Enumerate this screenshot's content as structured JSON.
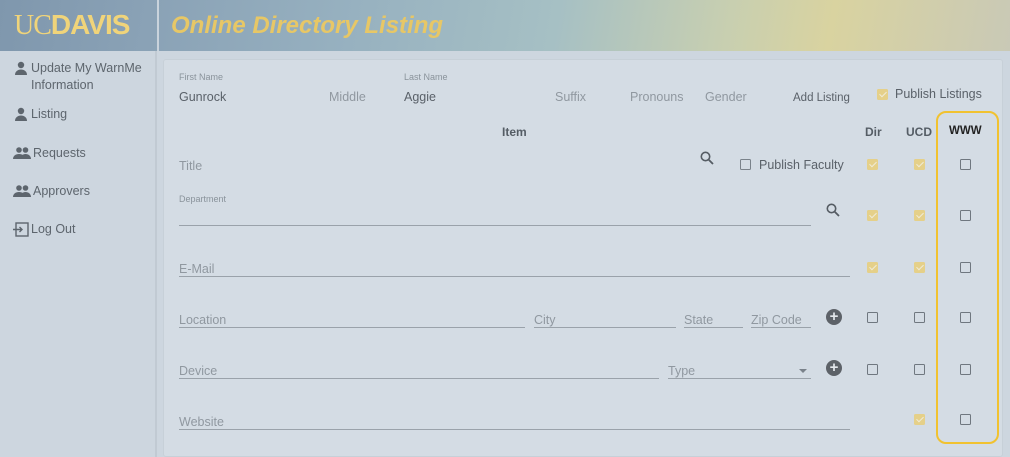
{
  "header": {
    "logo_uc": "UC",
    "logo_davis": "DAVIS",
    "app_title": "Online Directory Listing"
  },
  "sidebar": {
    "items": [
      {
        "label": "Update My WarnMe Information",
        "icon": "person-icon"
      },
      {
        "label": "Listing",
        "icon": "person-icon"
      },
      {
        "label": "Requests",
        "icon": "people-icon"
      },
      {
        "label": "Approvers",
        "icon": "people-icon"
      },
      {
        "label": "Log Out",
        "icon": "logout-icon"
      }
    ]
  },
  "name_row": {
    "first_name_label": "First Name",
    "first_name_value": "Gunrock",
    "middle_placeholder": "Middle",
    "last_name_label": "Last Name",
    "last_name_value": "Aggie",
    "suffix_placeholder": "Suffix",
    "pronouns_placeholder": "Pronouns",
    "gender_placeholder": "Gender",
    "add_listing": "Add Listing",
    "publish_listings": "Publish Listings",
    "publish_listings_checked": true
  },
  "columns": {
    "item": "Item",
    "dir": "Dir",
    "ucd": "UCD",
    "www": "WWW"
  },
  "rows": {
    "title": {
      "placeholder": "Title",
      "publish_faculty": "Publish Faculty",
      "dir": true,
      "ucd": true,
      "www": false
    },
    "department": {
      "label": "Department",
      "dir": true,
      "ucd": true,
      "www": false
    },
    "email": {
      "placeholder": "E-Mail",
      "dir": true,
      "ucd": true,
      "www": false
    },
    "location": {
      "location": "Location",
      "city": "City",
      "state": "State",
      "zip": "Zip Code",
      "dir": false,
      "ucd": false,
      "www": false
    },
    "device": {
      "device": "Device",
      "type": "Type",
      "dir": false,
      "ucd": false,
      "www": false
    },
    "website": {
      "placeholder": "Website",
      "ucd": true,
      "www": false
    }
  },
  "colors": {
    "accent": "#f1c230",
    "gold": "#e7c766",
    "checked": "#e8cf7a"
  }
}
